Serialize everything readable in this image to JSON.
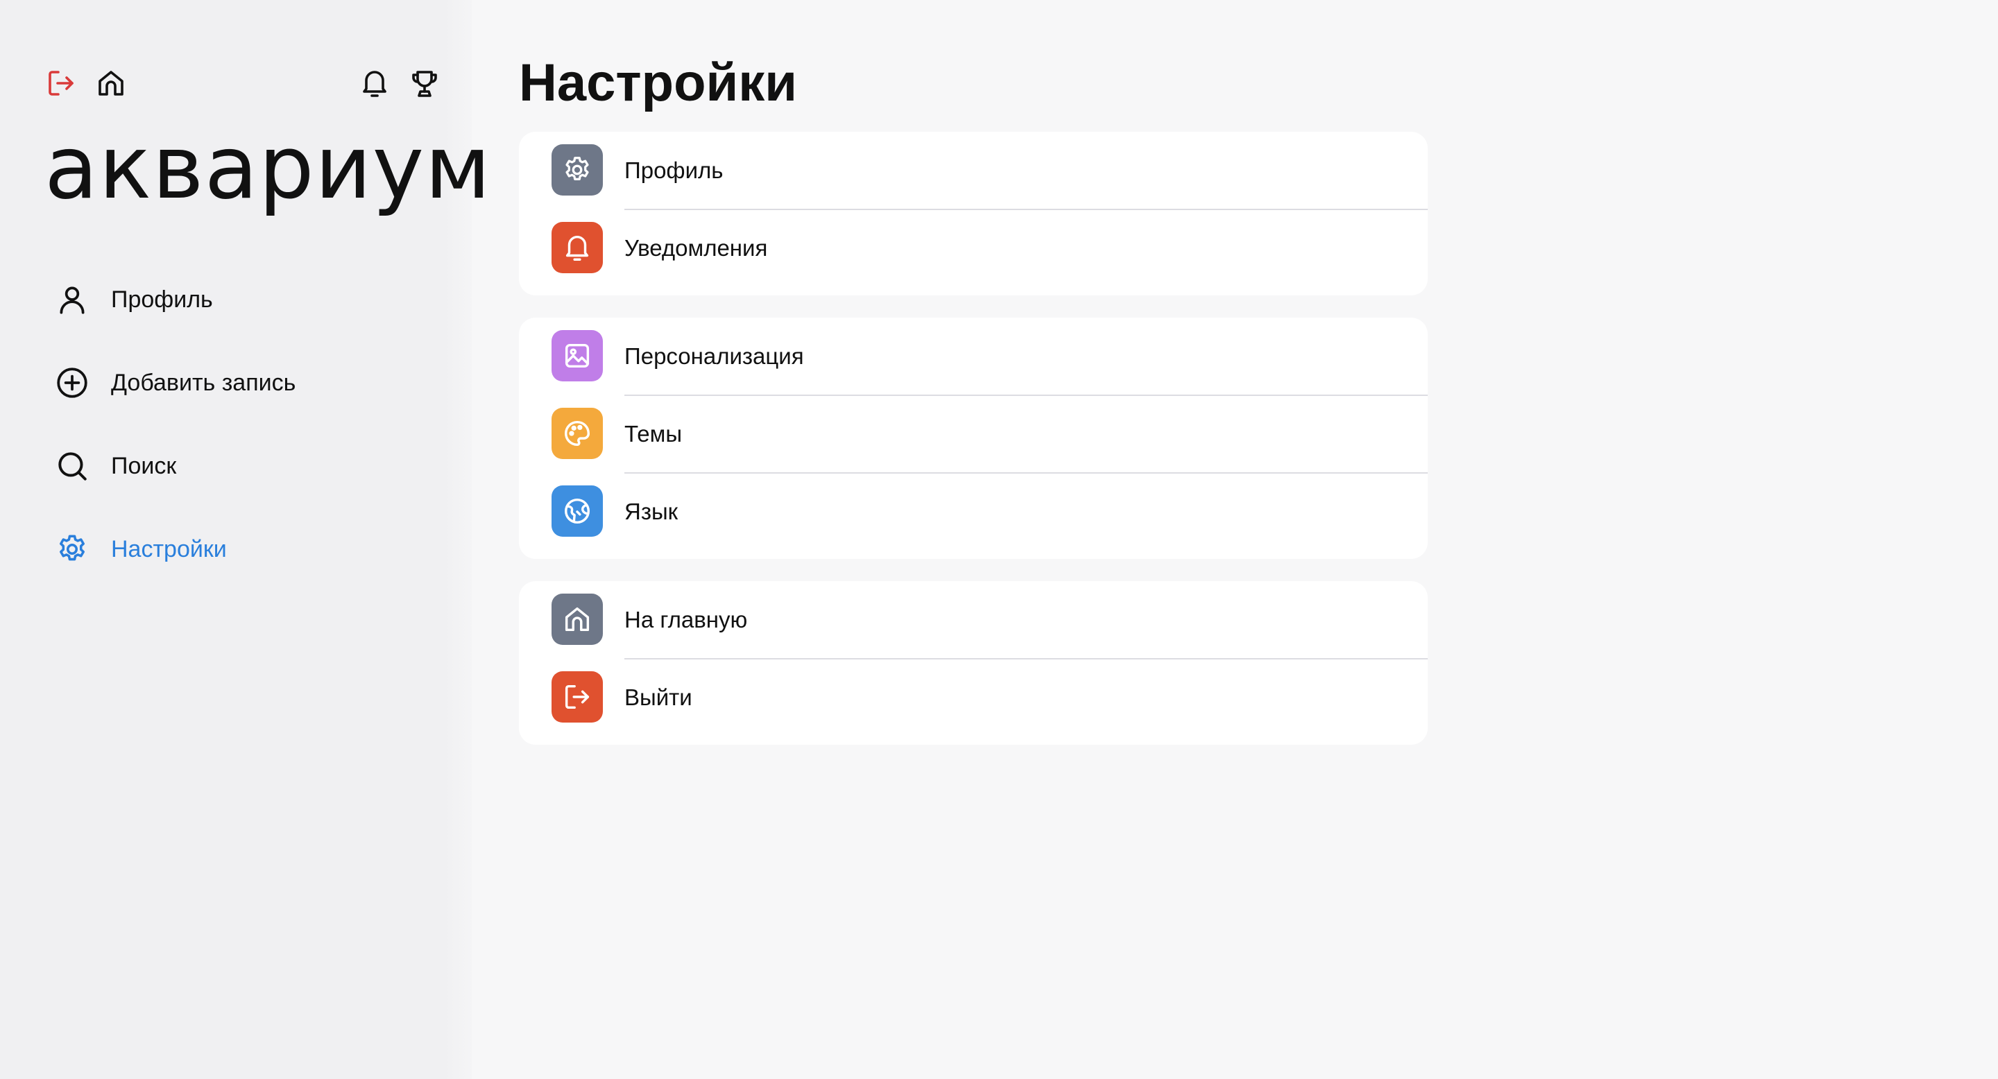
{
  "sidebar": {
    "brand": "аквариум",
    "top_icons": {
      "logout": "logout-icon",
      "home": "home-icon",
      "notifications": "bell-icon",
      "achievements": "trophy-icon"
    },
    "nav": [
      {
        "label": "Профиль",
        "icon": "user-icon",
        "active": false
      },
      {
        "label": "Добавить запись",
        "icon": "plus-circle-icon",
        "active": false
      },
      {
        "label": "Поиск",
        "icon": "search-icon",
        "active": false
      },
      {
        "label": "Настройки",
        "icon": "gear-icon",
        "active": true
      }
    ]
  },
  "main": {
    "title": "Настройки",
    "groups": [
      {
        "rows": [
          {
            "label": "Профиль",
            "icon": "gear-icon",
            "color": "#6e7788"
          },
          {
            "label": "Уведомления",
            "icon": "bell-icon",
            "color": "#e0512f"
          }
        ]
      },
      {
        "rows": [
          {
            "label": "Персонализация",
            "icon": "image-icon",
            "color": "#c07ee8"
          },
          {
            "label": "Темы",
            "icon": "palette-icon",
            "color": "#f4a93c"
          },
          {
            "label": "Язык",
            "icon": "globe-icon",
            "color": "#3e8fe0"
          }
        ]
      },
      {
        "rows": [
          {
            "label": "На главную",
            "icon": "home-icon",
            "color": "#6e7788"
          },
          {
            "label": "Выйти",
            "icon": "logout-icon",
            "color": "#e0512f"
          }
        ]
      }
    ]
  },
  "colors": {
    "accent": "#2a7fdc",
    "danger": "#d93a3a",
    "sidebar_bg": "#f0f0f2",
    "main_bg": "#f7f7f8",
    "card_bg": "#ffffff"
  }
}
